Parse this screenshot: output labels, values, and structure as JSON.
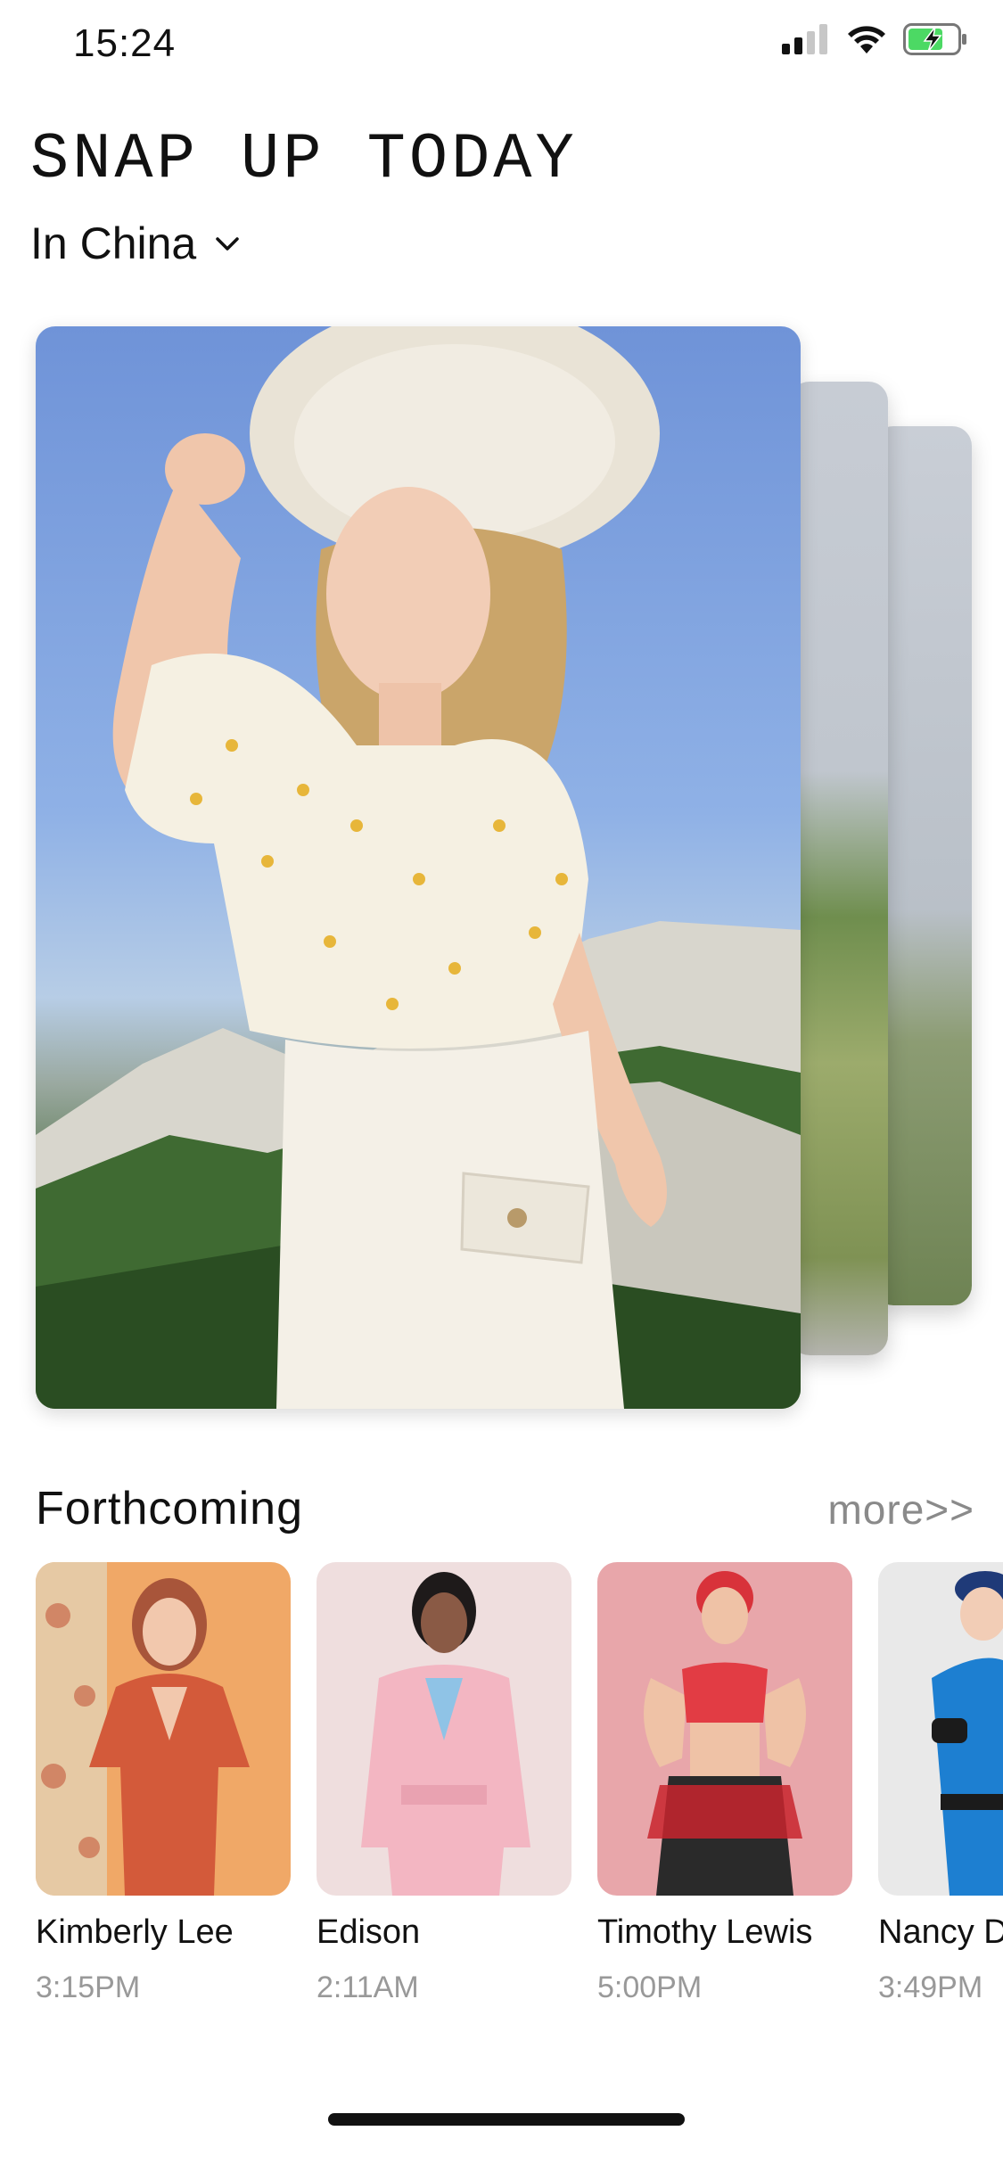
{
  "status_bar": {
    "time": "15:24"
  },
  "header": {
    "title": "SNAP UP TODAY",
    "location": "In China"
  },
  "featured": {
    "cards": 3
  },
  "forthcoming": {
    "title": "Forthcoming",
    "more_label": "more>>",
    "items": [
      {
        "name": "Kimberly Lee",
        "time": "3:15PM"
      },
      {
        "name": "Edison",
        "time": "2:11AM"
      },
      {
        "name": "Timothy Lewis",
        "time": "5:00PM"
      },
      {
        "name": "Nancy D",
        "time": "3:49PM"
      }
    ]
  },
  "icons": {
    "signal": "cellular-signal-icon",
    "wifi": "wifi-icon",
    "battery": "battery-charging-icon",
    "chevron": "chevron-down-icon"
  },
  "colors": {
    "battery_green": "#4cd964",
    "muted_text": "#999999",
    "more_text": "#8a8a8a"
  }
}
